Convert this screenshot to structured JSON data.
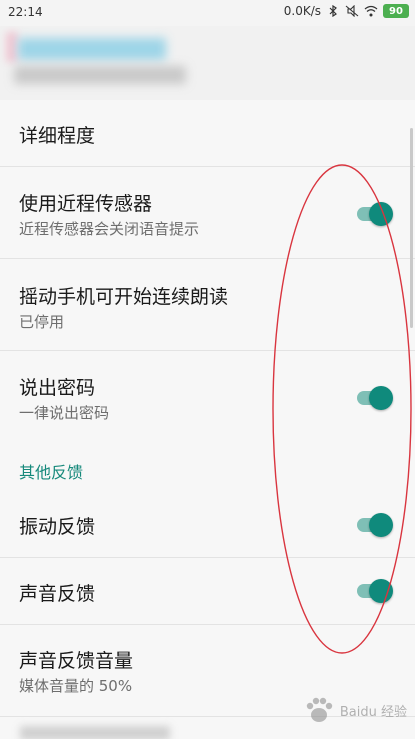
{
  "status_bar": {
    "time": "22:14",
    "network_speed": "0.0K/s",
    "battery": "90",
    "icons": [
      "bluetooth-icon",
      "mute-icon",
      "wifi-icon",
      "battery-icon"
    ]
  },
  "header": {
    "blurred": true
  },
  "settings": {
    "verbosity": {
      "title": "详细程度"
    },
    "proximity": {
      "title": "使用近程传感器",
      "subtitle": "近程传感器会关闭语音提示",
      "enabled": true
    },
    "shake": {
      "title": "摇动手机可开始连续朗读",
      "subtitle": "已停用"
    },
    "passwords": {
      "title": "说出密码",
      "subtitle": "一律说出密码",
      "enabled": true
    },
    "other_feedback": {
      "section_title": "其他反馈"
    },
    "vibration": {
      "title": "振动反馈",
      "enabled": true
    },
    "sound": {
      "title": "声音反馈",
      "enabled": true
    },
    "sound_volume": {
      "title": "声音反馈音量",
      "subtitle": "媒体音量的 50%"
    }
  },
  "colors": {
    "accent": "#16897b",
    "thumb": "#0f8a7c",
    "track": "#7fbfb6",
    "annotation": "#d9353f"
  },
  "watermark": {
    "text": "Baidu 经验"
  }
}
